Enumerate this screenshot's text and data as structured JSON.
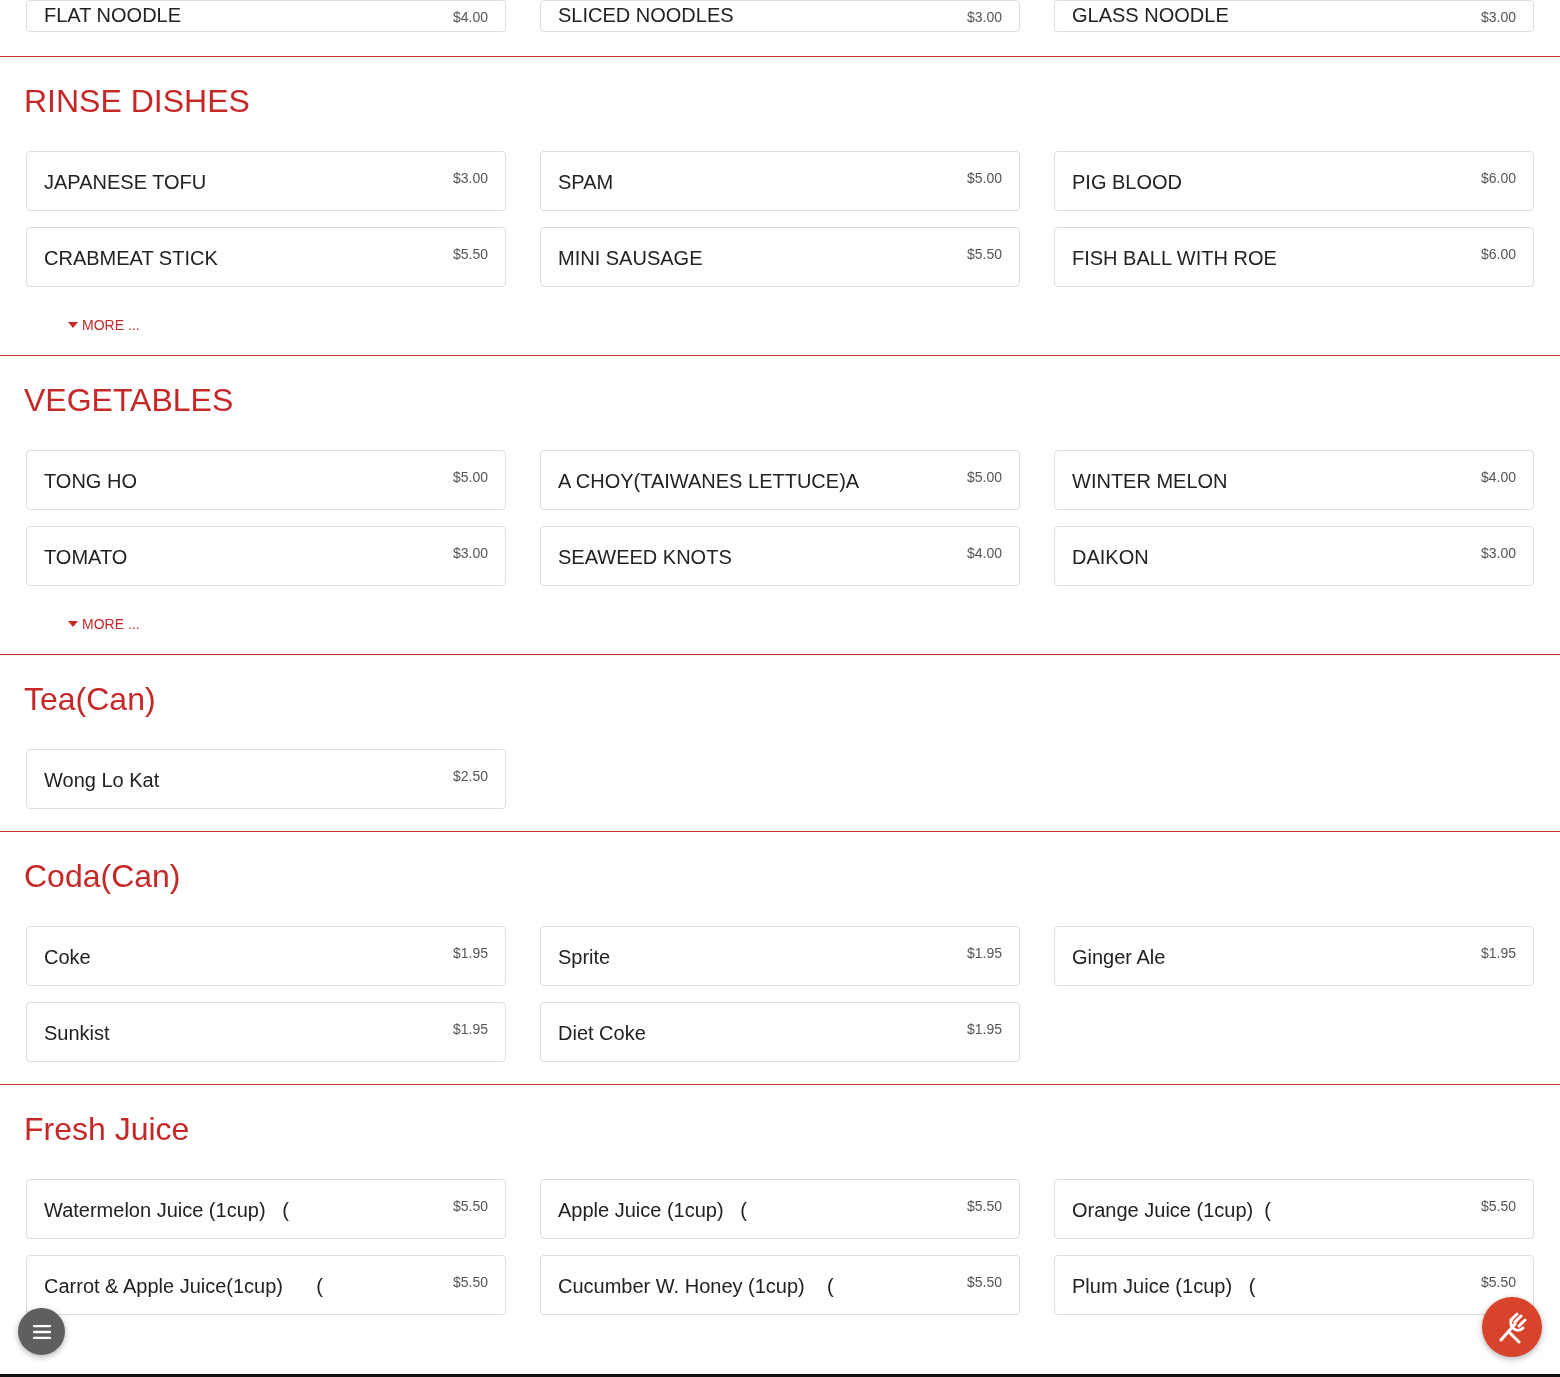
{
  "top_items": [
    {
      "name": "FLAT NOODLE",
      "price": "$4.00"
    },
    {
      "name": "SLICED NOODLES",
      "price": "$3.00"
    },
    {
      "name": "GLASS NOODLE",
      "price": "$3.00"
    }
  ],
  "sections": [
    {
      "title": "RINSE DISHES",
      "items": [
        {
          "name": "JAPANESE TOFU",
          "price": "$3.00"
        },
        {
          "name": "SPAM",
          "price": "$5.00"
        },
        {
          "name": "PIG BLOOD",
          "price": "$6.00"
        },
        {
          "name": "CRABMEAT STICK",
          "price": "$5.50"
        },
        {
          "name": "MINI SAUSAGE",
          "price": "$5.50"
        },
        {
          "name": "FISH BALL WITH ROE",
          "price": "$6.00"
        }
      ],
      "more": "MORE ..."
    },
    {
      "title": "VEGETABLES",
      "items": [
        {
          "name": "TONG HO",
          "price": "$5.00"
        },
        {
          "name": "A CHOY(TAIWANES LETTUCE)A",
          "price": "$5.00"
        },
        {
          "name": "WINTER MELON",
          "price": "$4.00"
        },
        {
          "name": "TOMATO",
          "price": "$3.00"
        },
        {
          "name": "SEAWEED KNOTS",
          "price": "$4.00"
        },
        {
          "name": "DAIKON",
          "price": "$3.00"
        }
      ],
      "more": "MORE ..."
    },
    {
      "title": "Tea(Can)",
      "items": [
        {
          "name": "Wong Lo Kat",
          "price": "$2.50"
        }
      ]
    },
    {
      "title": "Coda(Can)",
      "items": [
        {
          "name": "Coke",
          "price": "$1.95"
        },
        {
          "name": "Sprite",
          "price": "$1.95"
        },
        {
          "name": "Ginger Ale",
          "price": "$1.95"
        },
        {
          "name": "Sunkist",
          "price": "$1.95"
        },
        {
          "name": "Diet Coke",
          "price": "$1.95"
        }
      ]
    },
    {
      "title": "Fresh Juice",
      "items": [
        {
          "name": "Watermelon Juice (1cup)   (",
          "price": "$5.50"
        },
        {
          "name": "Apple Juice (1cup)   (",
          "price": "$5.50"
        },
        {
          "name": "Orange Juice (1cup)  (",
          "price": "$5.50"
        },
        {
          "name": "Carrot & Apple Juice(1cup)      (",
          "price": "$5.50"
        },
        {
          "name": "Cucumber W. Honey (1cup)    (",
          "price": "$5.50"
        },
        {
          "name": "Plum Juice (1cup)   (",
          "price": "$5.50"
        }
      ]
    }
  ]
}
